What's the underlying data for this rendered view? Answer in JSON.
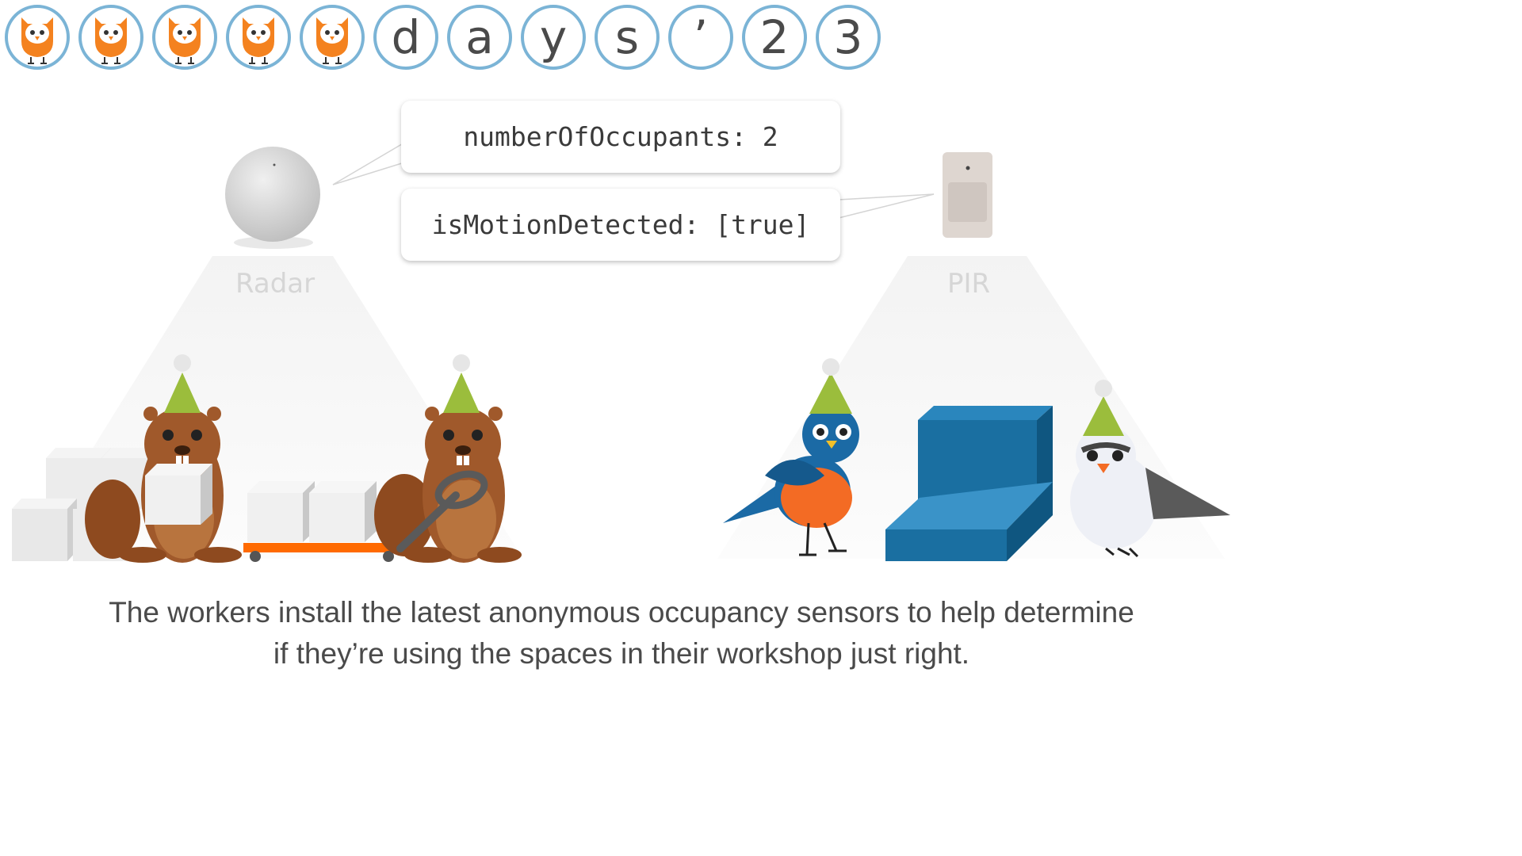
{
  "banner": {
    "owl_icon": "owl-icon",
    "owl_count": 5,
    "characters": [
      "d",
      "a",
      "y",
      "s",
      "’",
      "2",
      "3"
    ],
    "ring_color": "#7bb4d6"
  },
  "sensors": {
    "radar": {
      "label": "Radar",
      "reading": "numberOfOccupants: 2"
    },
    "pir": {
      "label": "PIR",
      "reading": "isMotionDetected: [true]"
    }
  },
  "caption": {
    "line1": "The workers install the latest anonymous occupancy sensors to help determine",
    "line2": "if they’re using the spaces in their workshop just right."
  },
  "colors": {
    "beaver": "#a0592b",
    "party_hat": "#9bbd3c",
    "blue_block": "#1a6fa1",
    "cart": "#ff6a00",
    "bluebird": "#1b6aa5",
    "bird_breast": "#f36b24"
  }
}
